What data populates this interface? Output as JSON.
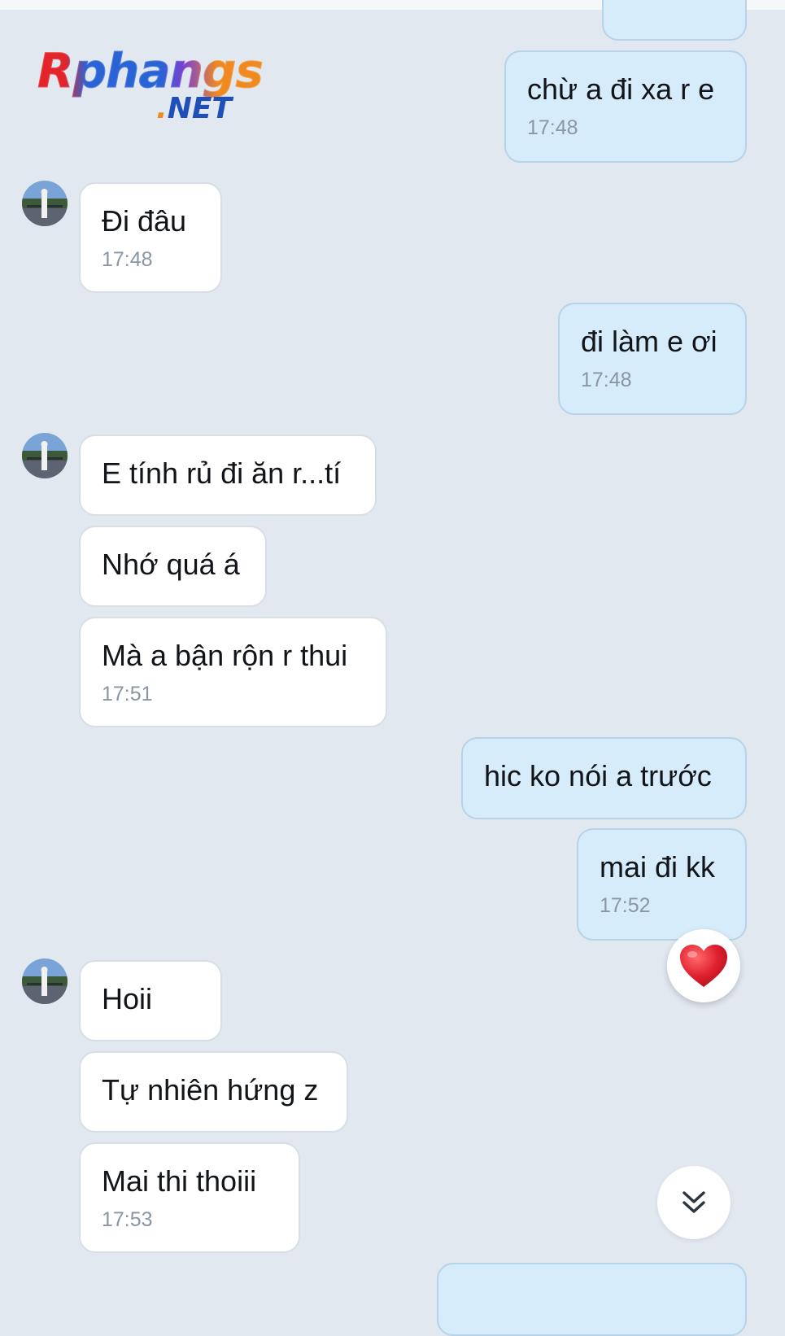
{
  "watermark": {
    "main": "Rphangs",
    "net_dot": ".",
    "net": "NET"
  },
  "messages": [
    {
      "id": "m1",
      "side": "out",
      "text": "chừ a đi xa r e",
      "time": "17:48"
    },
    {
      "id": "m2",
      "side": "in",
      "text": "Đi đâu",
      "time": "17:48"
    },
    {
      "id": "m3",
      "side": "out",
      "text": "đi làm e ơi",
      "time": "17:48"
    },
    {
      "id": "m4",
      "side": "in",
      "text": "E tính rủ đi ăn r...tí",
      "time": ""
    },
    {
      "id": "m5",
      "side": "in",
      "text": "Nhớ quá á",
      "time": ""
    },
    {
      "id": "m6",
      "side": "in",
      "text": "Mà a bận rộn r thui",
      "time": "17:51"
    },
    {
      "id": "m7",
      "side": "out",
      "text": "hic ko nói a trước",
      "time": ""
    },
    {
      "id": "m8",
      "side": "out",
      "text": "mai đi kk",
      "time": "17:52",
      "reaction": "heart"
    },
    {
      "id": "m9",
      "side": "in",
      "text": "Hoii",
      "time": ""
    },
    {
      "id": "m10",
      "side": "in",
      "text": "Tự nhiên hứng z",
      "time": ""
    },
    {
      "id": "m11",
      "side": "in",
      "text": "Mai thi thoiii",
      "time": "17:53"
    }
  ],
  "icons": {
    "reaction": "red-heart-icon",
    "scroll": "double-chevron-down-icon",
    "avatar": "contact-avatar"
  },
  "colors": {
    "background": "#e2e8f0",
    "incoming_bubble": "#ffffff",
    "outgoing_bubble": "#d6ecfb",
    "timestamp": "#8a96a3",
    "heart": "#e0202e"
  }
}
